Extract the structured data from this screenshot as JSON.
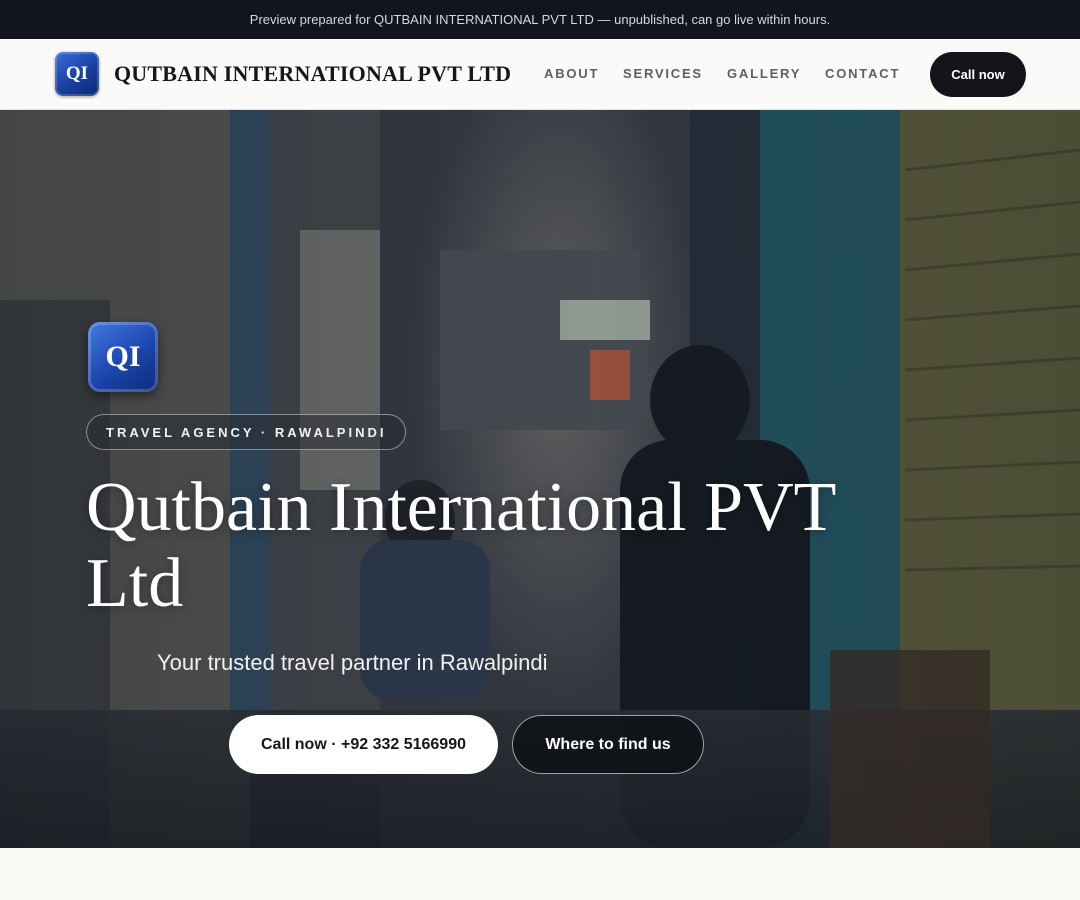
{
  "preview_banner": "Preview prepared for QUTBAIN INTERNATIONAL PVT LTD — unpublished, can go live within hours.",
  "navbar": {
    "logo_initials": "QI",
    "brand_name": "QUTBAIN INTERNATIONAL PVT LTD",
    "links": [
      {
        "label": "ABOUT"
      },
      {
        "label": "SERVICES"
      },
      {
        "label": "GALLERY"
      },
      {
        "label": "CONTACT"
      }
    ],
    "cta_label": "Call now"
  },
  "hero": {
    "logo_initials": "QI",
    "badge": "TRAVEL AGENCY · RAWALPINDI",
    "title": "Qutbain International PVT Ltd",
    "subtitle": "Your trusted travel partner in Rawalpindi",
    "primary_button": "Call now · +92 332 5166990",
    "secondary_button": "Where to find us",
    "background_image": "market-alley-photo"
  },
  "colors": {
    "dark": "#12151b",
    "logo_blue": "#1b46ad",
    "page_bg": "#f9f8f5"
  }
}
